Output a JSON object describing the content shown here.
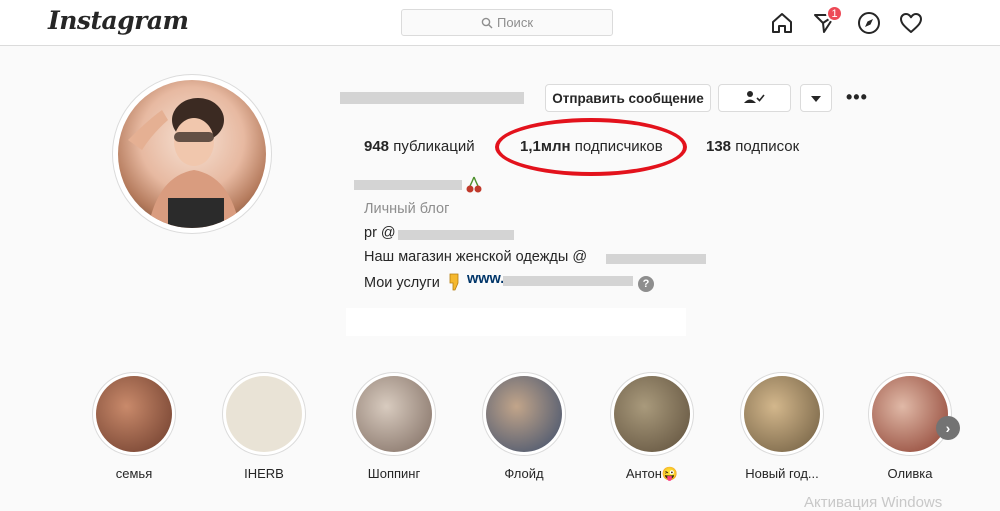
{
  "app": {
    "logo_text": "Instagram"
  },
  "search": {
    "placeholder": "Поиск"
  },
  "nav": {
    "direct_badge": "1"
  },
  "profile": {
    "buttons": {
      "message": "Отправить сообщение",
      "follow_status_icon": "person-check-icon",
      "dropdown_icon": "triangle-down-icon",
      "more_icon": "ellipsis-icon"
    },
    "stats": {
      "posts_value": "948",
      "posts_label": "публикаций",
      "followers_value": "1,1млн",
      "followers_label": "подписчиков",
      "following_value": "138",
      "following_label": "подписок"
    },
    "bio": {
      "category": "Личный блог",
      "pr_prefix": "pr @",
      "shop_text": "Наш магазин женской одежды @",
      "services_text": "Мои услуги",
      "website_prefix": "www.",
      "help_mark": "?"
    }
  },
  "highlights": [
    {
      "label": "семья",
      "colors": [
        "#6b3a2a",
        "#c98a6b"
      ]
    },
    {
      "label": "IHERB",
      "colors": [
        "#e9e3d6",
        "#e9e3d6"
      ]
    },
    {
      "label": "Шоппинг",
      "colors": [
        "#7d6a5f",
        "#d8cbbf"
      ]
    },
    {
      "label": "Флойд",
      "colors": [
        "#3a4c6b",
        "#c2a58a"
      ]
    },
    {
      "label": "Антон😜",
      "colors": [
        "#5d4e3a",
        "#a99a7c"
      ]
    },
    {
      "label": "Новый год...",
      "colors": [
        "#6c5a3e",
        "#d3b78c"
      ]
    },
    {
      "label": "Оливка",
      "colors": [
        "#8a3b2c",
        "#e0b9a7"
      ]
    }
  ],
  "overlay": {
    "watermark": "Активация Windows"
  },
  "colors": {
    "accent_red": "#e3121c",
    "badge": "#ed4956",
    "link": "#003569"
  }
}
